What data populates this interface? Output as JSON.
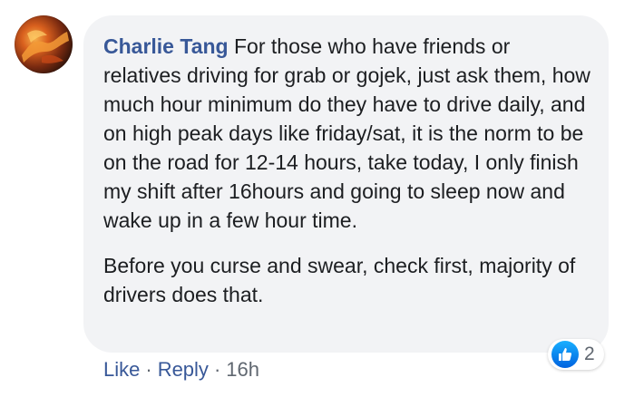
{
  "comment": {
    "author": "Charlie Tang",
    "paragraph1": "For those who have friends or relatives driving for grab or gojek, just ask them, how much hour minimum do they have to drive daily, and on high peak days like friday/sat, it is the norm to be on the road for 12-14 hours, take today, I only finish my shift after 16hours and going to sleep now and wake up in a few hour time.",
    "paragraph2": "Before you curse and swear, check first, majority of drivers does that."
  },
  "reactions": {
    "icon": "like-icon",
    "count": "2",
    "color": "#1877f2"
  },
  "actions": {
    "like_label": "Like",
    "separator": "·",
    "reply_label": "Reply",
    "timestamp": "16h"
  },
  "colors": {
    "author_link": "#385898",
    "bubble_bg": "#f2f3f5",
    "meta_text": "#606770"
  }
}
